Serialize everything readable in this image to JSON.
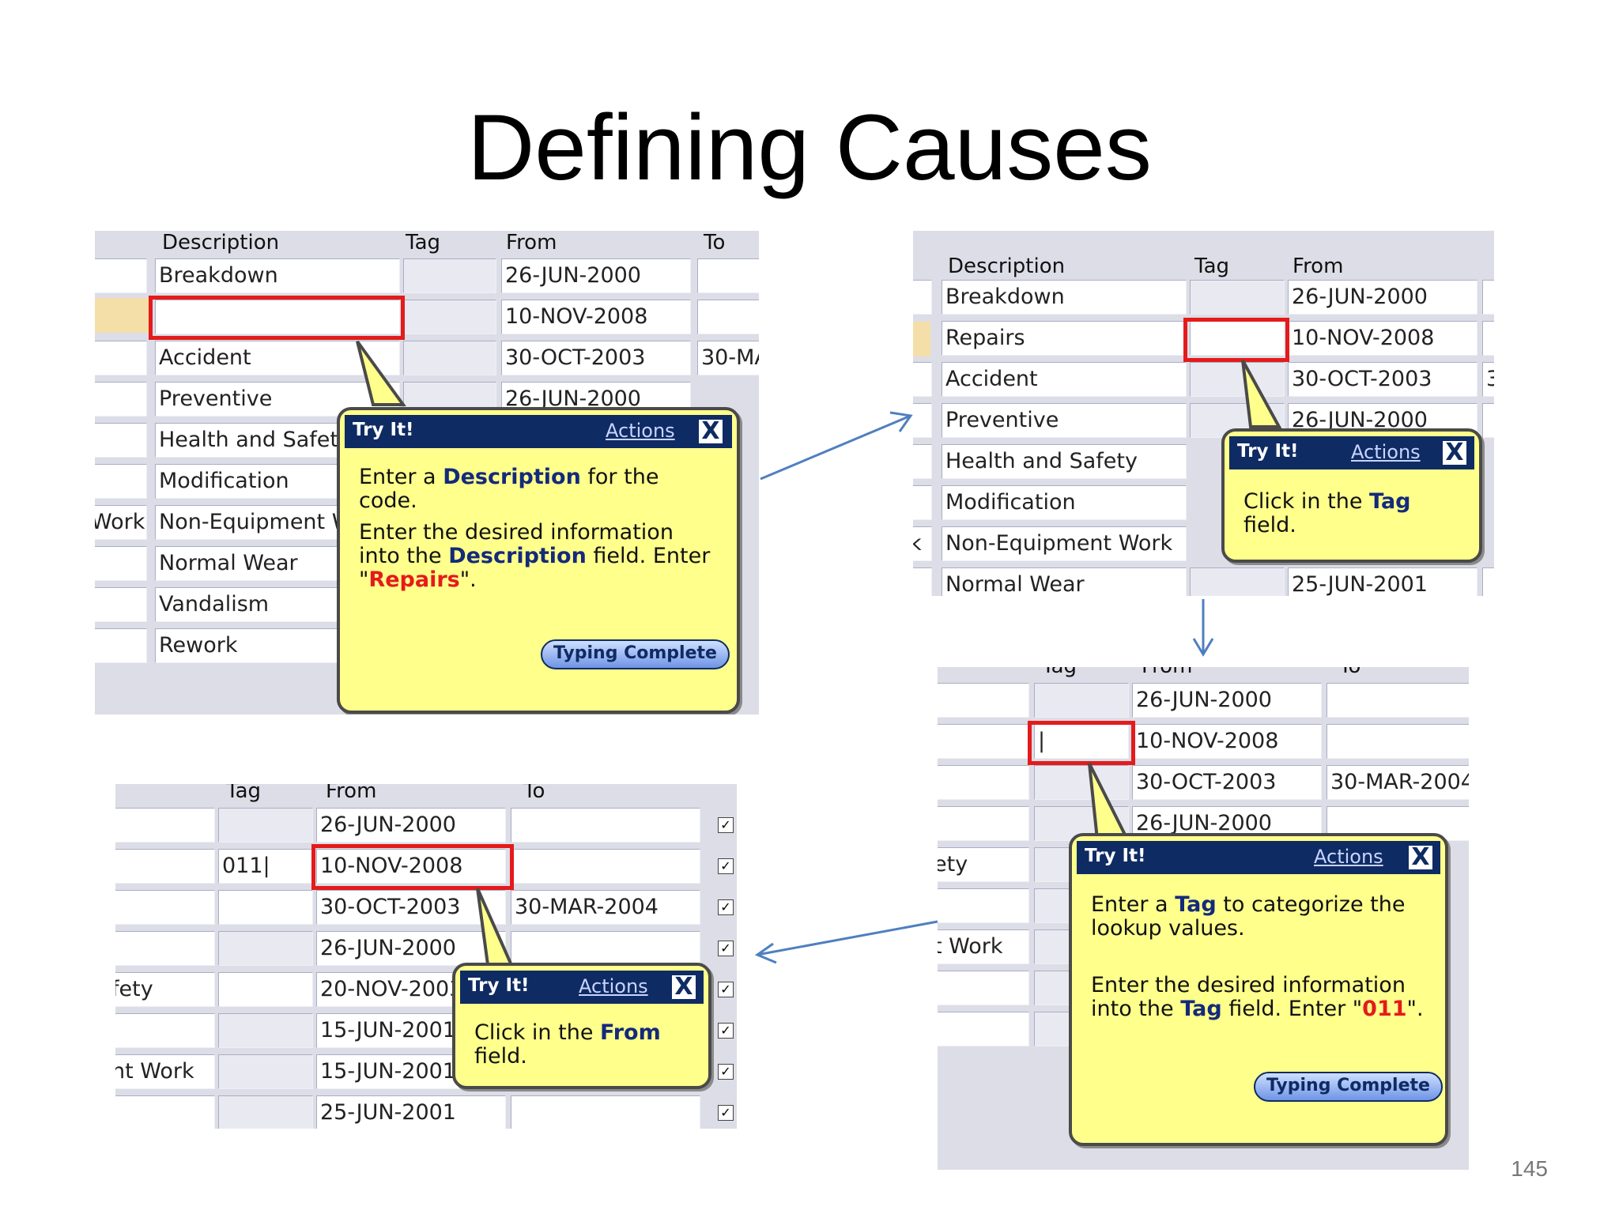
{
  "slide": {
    "title": "Defining Causes",
    "page_number": "145"
  },
  "headers": {
    "description": "Description",
    "tag": "Tag",
    "from": "From",
    "to": "To"
  },
  "shot1": {
    "descriptions": [
      "Breakdown",
      "",
      "Accident",
      "Preventive",
      "Health and Safety",
      "Modification",
      "Non-Equipment W",
      "Normal Wear",
      "Vandalism",
      "Rework"
    ],
    "side_cut": "Work",
    "from_values": [
      "26-JUN-2000",
      "10-NOV-2008",
      "30-OCT-2003",
      "26-JUN-2000"
    ],
    "to_values": [
      "",
      "",
      "30-MA"
    ],
    "bubble": {
      "try": "Try It!",
      "actions": "Actions",
      "close": "X",
      "line1_a": "Enter a ",
      "line1_kw": "Description",
      "line1_b": " for the code.",
      "line2_a": "Enter the desired information into the ",
      "line2_kw": "Description",
      "line2_b": " field. Enter \"",
      "line2_val": "Repairs",
      "line2_c": "\".",
      "button": "Typing Complete"
    }
  },
  "shot2": {
    "descriptions": [
      "Breakdown",
      "Repairs",
      "Accident",
      "Preventive",
      "Health and Safety",
      "Modification",
      "Non-Equipment Work",
      "Normal Wear"
    ],
    "side_cut": "k",
    "from_values": [
      "26-JUN-2000",
      "10-NOV-2008",
      "30-OCT-2003",
      "26-JUN-2000",
      "",
      "",
      "",
      "25-JUN-2001"
    ],
    "to_cut": "3",
    "bubble": {
      "try": "Try It!",
      "actions": "Actions",
      "close": "X",
      "line1_a": "Click in the ",
      "line1_kw": "Tag",
      "line1_b": " field."
    }
  },
  "shot3": {
    "side_cuts": [
      "",
      "",
      "",
      "",
      "ety",
      "",
      "t Work",
      "",
      "",
      ""
    ],
    "from_values": [
      "26-JUN-2000",
      "10-NOV-2008",
      "30-OCT-2003",
      "26-JUN-2000"
    ],
    "to_values": [
      "",
      "",
      "30-MAR-2004"
    ],
    "cursor": "|",
    "bubble": {
      "try": "Try It!",
      "actions": "Actions",
      "close": "X",
      "line1_a": "Enter a ",
      "line1_kw": "Tag",
      "line1_b": " to categorize the lookup values.",
      "line2_a": "Enter the desired information into the ",
      "line2_kw": "Tag",
      "line2_b": " field. Enter \"",
      "line2_val": "011",
      "line2_c": "\".",
      "button": "Typing Complete"
    }
  },
  "shot4": {
    "side_cuts": [
      "",
      "",
      "",
      "",
      "fety",
      "",
      "nt Work",
      ""
    ],
    "tag_values": [
      "",
      "011|",
      "",
      "",
      "",
      "",
      "",
      ""
    ],
    "from_values": [
      "26-JUN-2000",
      "10-NOV-2008",
      "30-OCT-2003",
      "26-JUN-2000",
      "20-NOV-2003",
      "15-JUN-2001",
      "15-JUN-2001",
      "25-JUN-2001"
    ],
    "to_values": [
      "",
      "",
      "30-MAR-2004",
      "",
      "",
      "",
      "",
      ""
    ],
    "checkmark": "✓",
    "bubble": {
      "try": "Try It!",
      "actions": "Actions",
      "close": "X",
      "line1_a": "Click in the ",
      "line1_kw": "From",
      "line1_b": " field."
    }
  }
}
